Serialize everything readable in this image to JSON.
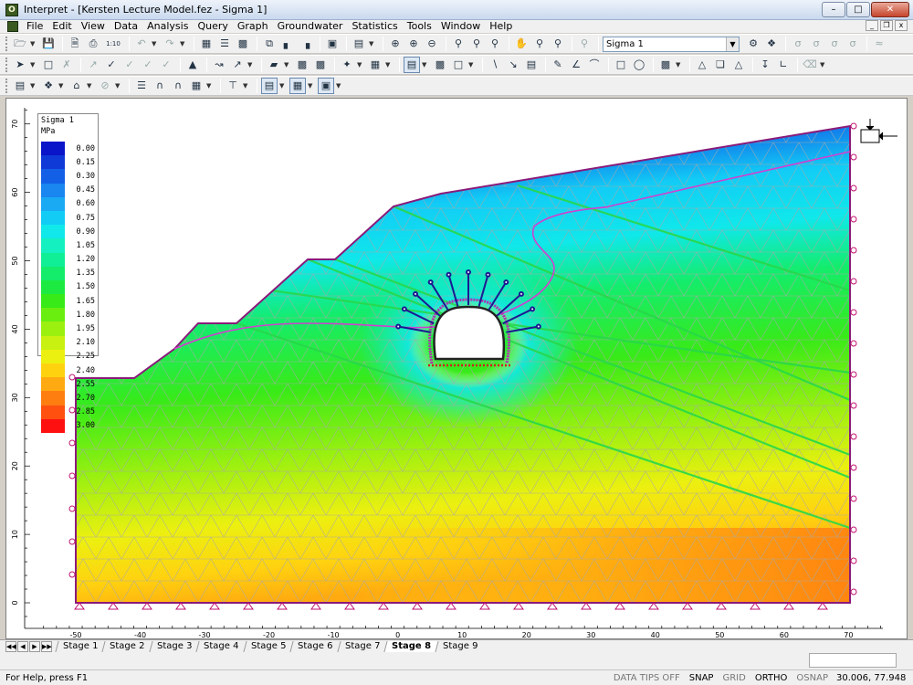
{
  "window": {
    "title": "Interpret - [Kersten Lecture Model.fez - Sigma 1]",
    "app_icon": "O"
  },
  "menu": [
    "File",
    "Edit",
    "View",
    "Data",
    "Analysis",
    "Query",
    "Graph",
    "Groundwater",
    "Statistics",
    "Tools",
    "Window",
    "Help"
  ],
  "toolbar": {
    "scale_label": "1:10",
    "data_selector": "Sigma 1"
  },
  "legend": {
    "title": "Sigma 1",
    "unit": "MPa",
    "entries": [
      {
        "value": "0.00",
        "color": "#0a14c8"
      },
      {
        "value": "0.15",
        "color": "#0f3ad8"
      },
      {
        "value": "0.30",
        "color": "#1360e6"
      },
      {
        "value": "0.45",
        "color": "#1a86ef"
      },
      {
        "value": "0.60",
        "color": "#1aaaf4"
      },
      {
        "value": "0.75",
        "color": "#12ccf6"
      },
      {
        "value": "0.90",
        "color": "#10e8ea"
      },
      {
        "value": "1.05",
        "color": "#14f0c0"
      },
      {
        "value": "1.20",
        "color": "#10ee96"
      },
      {
        "value": "1.35",
        "color": "#14ec6c"
      },
      {
        "value": "1.50",
        "color": "#1cea40"
      },
      {
        "value": "1.65",
        "color": "#38ea18"
      },
      {
        "value": "1.80",
        "color": "#6aee10"
      },
      {
        "value": "1.95",
        "color": "#9cf010"
      },
      {
        "value": "2.10",
        "color": "#c8f010"
      },
      {
        "value": "2.25",
        "color": "#ecf010"
      },
      {
        "value": "2.40",
        "color": "#ffd210"
      },
      {
        "value": "2.55",
        "color": "#ffaa10"
      },
      {
        "value": "2.70",
        "color": "#ff7e10"
      },
      {
        "value": "2.85",
        "color": "#ff5010"
      },
      {
        "value": "3.00",
        "color": "#ff1010"
      }
    ]
  },
  "axes": {
    "x_ticks": [
      "-50",
      "-40",
      "-30",
      "-20",
      "-10",
      "0",
      "10",
      "20",
      "30",
      "40",
      "50",
      "60",
      "70"
    ],
    "y_ticks": [
      "0",
      "10",
      "20",
      "30",
      "40",
      "50",
      "60",
      "70"
    ]
  },
  "tabs": [
    "Stage 1",
    "Stage 2",
    "Stage 3",
    "Stage 4",
    "Stage 5",
    "Stage 6",
    "Stage 7",
    "Stage 8",
    "Stage 9"
  ],
  "active_tab": "Stage 8",
  "status": {
    "help": "For Help, press F1",
    "data_tips": "DATA TIPS OFF",
    "snap": "SNAP",
    "grid": "GRID",
    "ortho": "ORTHO",
    "osnap": "OSNAP",
    "coords": "30.006, 77.948"
  }
}
